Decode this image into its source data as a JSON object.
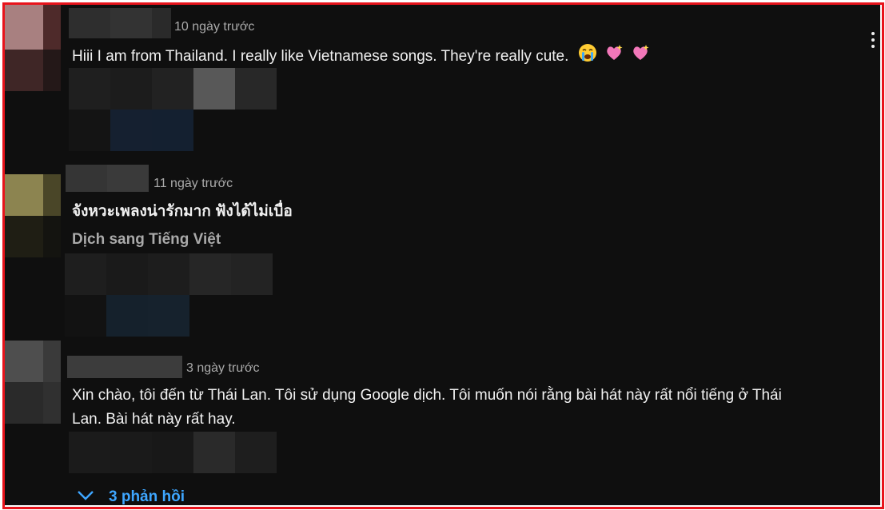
{
  "comments": [
    {
      "timestamp": "10 ngày trước",
      "text": "Hiii I am from Thailand. I really like Vietnamese songs. They're really cute.",
      "emojis": [
        "crying-face",
        "sparkling-heart",
        "sparkling-heart"
      ]
    },
    {
      "timestamp": "11 ngày trước",
      "text": "จังหวะเพลงน่ารักมาก ฟังได้ไม่เบื่อ",
      "translate_label": "Dịch sang Tiếng Việt"
    },
    {
      "timestamp": "3 ngày trước",
      "text_line1": "Xin chào, tôi đến từ Thái Lan. Tôi sử dụng Google dịch. Tôi muốn nói rằng bài hát này rất nổi tiếng ở Thái",
      "text_line2": "Lan. Bài hát này rất hay."
    }
  ],
  "replies_label": "3 phản hồi",
  "colors": {
    "accent": "#3ea6ff",
    "frame": "#e8131b",
    "background": "#0f0f0f"
  }
}
